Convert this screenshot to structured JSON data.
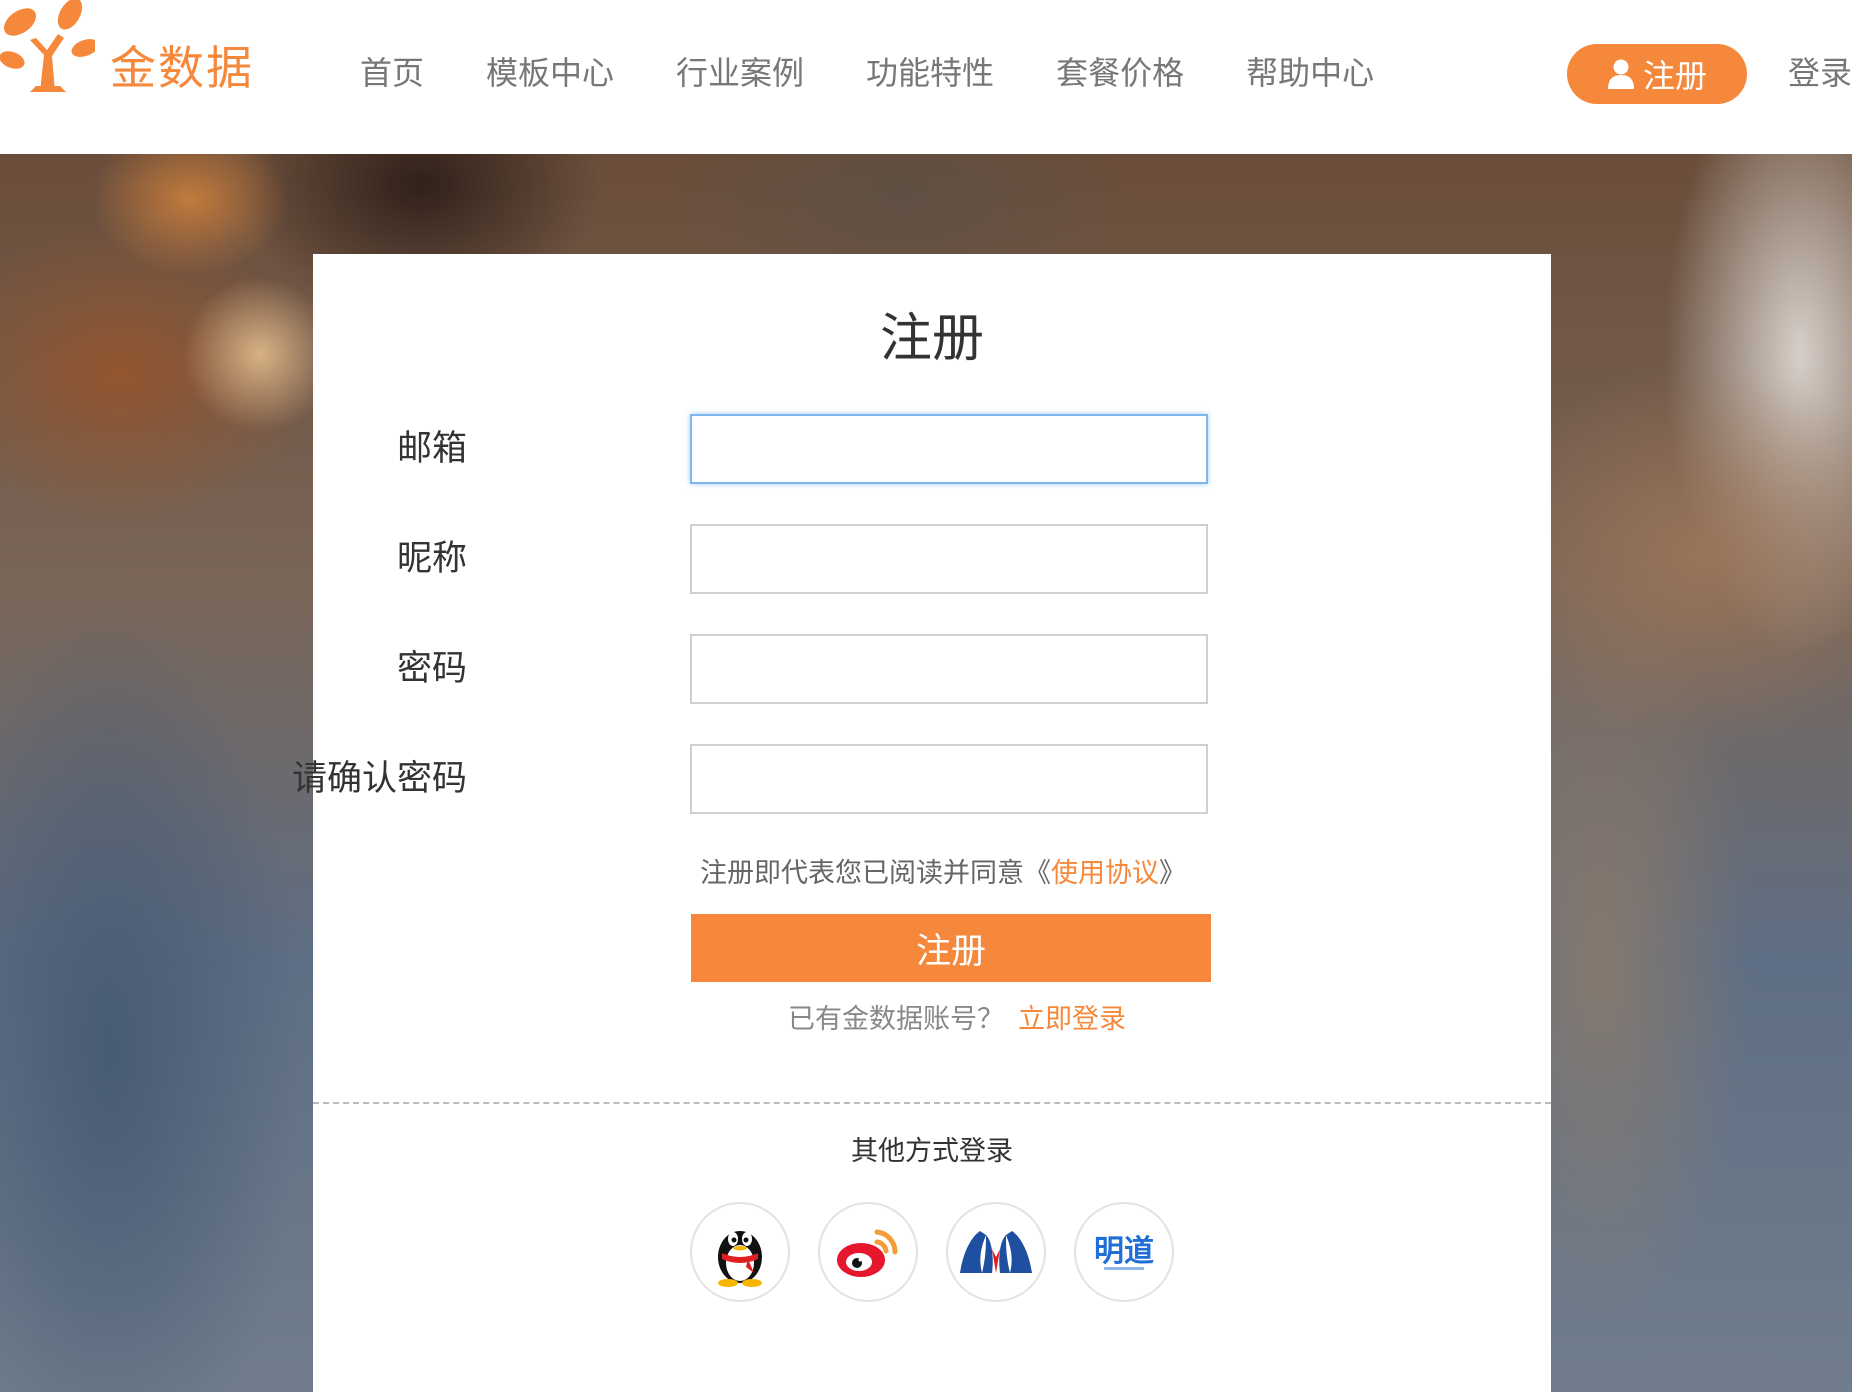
{
  "header": {
    "brand": "金数据",
    "nav": [
      "首页",
      "模板中心",
      "行业案例",
      "功能特性",
      "套餐价格",
      "帮助中心"
    ],
    "register_label": "注册",
    "login_label": "登录"
  },
  "form": {
    "title": "注册",
    "fields": [
      {
        "label": "邮箱",
        "value": ""
      },
      {
        "label": "昵称",
        "value": ""
      },
      {
        "label": "密码",
        "value": ""
      },
      {
        "label": "请确认密码",
        "value": ""
      }
    ],
    "agreement_prefix": "注册即代表您已阅读并同意《",
    "agreement_link": "使用协议",
    "agreement_suffix": "》",
    "submit_label": "注册",
    "have_account": "已有金数据账号？",
    "login_now": "立即登录"
  },
  "social": {
    "title": "其他方式登录",
    "providers": [
      "qq-icon",
      "weibo-icon",
      "renren-icon",
      "mingdao-icon"
    ],
    "mingdao_text": "明道"
  },
  "colors": {
    "accent": "#f5883a",
    "focus_border": "#7db7ee"
  }
}
